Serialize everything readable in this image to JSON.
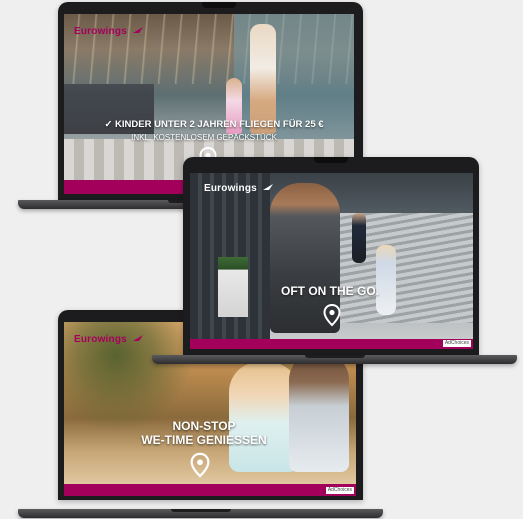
{
  "laptops": [
    {
      "brand": "Eurowings",
      "headline_line1": "✓ KINDER UNTER 2 JAHREN FLIEGEN FÜR 25 €",
      "headline_line2": "INKL. KOSTENLOSEM GEPÄCKSTÜCK"
    },
    {
      "brand": "Eurowings",
      "headline": "OFT ON THE GO.",
      "adchoices": "AdChoices"
    },
    {
      "brand": "Eurowings",
      "headline_line1": "NON-STOP",
      "headline_line2": "WE-TIME GENIESSEN",
      "adchoices": "AdChoices"
    }
  ],
  "colors": {
    "brand_magenta": "#a3005b",
    "bezel": "#1c1c1e",
    "background": "#efefef"
  },
  "icons": [
    "wing-logo-icon",
    "location-pin-icon"
  ]
}
